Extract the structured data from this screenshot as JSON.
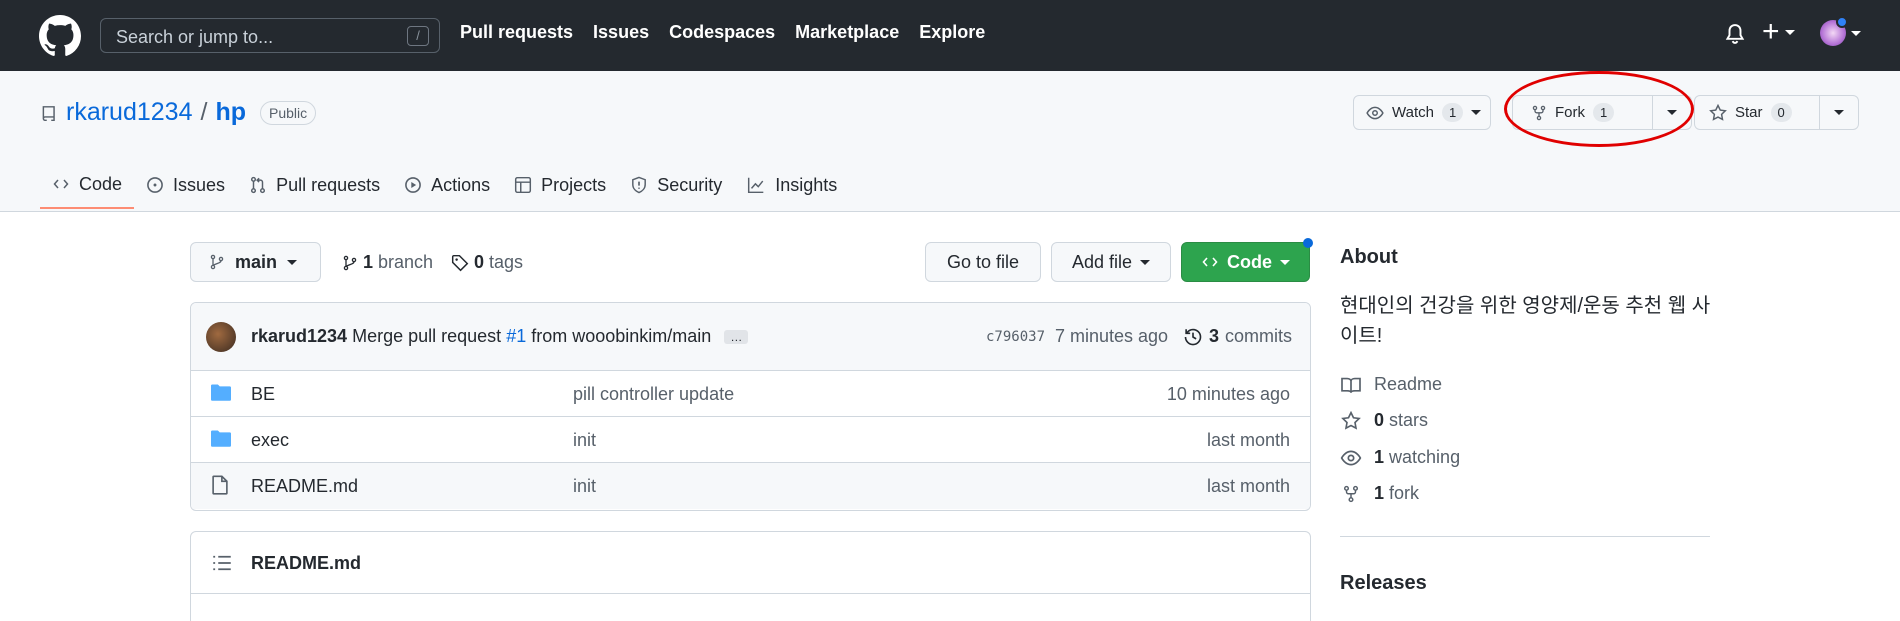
{
  "topbar": {
    "search_placeholder": "Search or jump to...",
    "search_key": "/",
    "nav": [
      "Pull requests",
      "Issues",
      "Codespaces",
      "Marketplace",
      "Explore"
    ],
    "plus_label": "+"
  },
  "repo": {
    "owner": "rkarud1234",
    "separator": "/",
    "name": "hp",
    "visibility": "Public",
    "watch": {
      "label": "Watch",
      "count": "1"
    },
    "fork": {
      "label": "Fork",
      "count": "1"
    },
    "star": {
      "label": "Star",
      "count": "0"
    }
  },
  "tabs": [
    {
      "label": "Code",
      "icon": "code-icon",
      "active": true
    },
    {
      "label": "Issues",
      "icon": "issue-icon"
    },
    {
      "label": "Pull requests",
      "icon": "pull-request-icon"
    },
    {
      "label": "Actions",
      "icon": "play-icon"
    },
    {
      "label": "Projects",
      "icon": "table-icon"
    },
    {
      "label": "Security",
      "icon": "shield-icon"
    },
    {
      "label": "Insights",
      "icon": "graph-icon"
    }
  ],
  "toolbar": {
    "branch": "main",
    "branch_count": "1",
    "branch_label": "branch",
    "tag_count": "0",
    "tag_label": "tags",
    "goto_file": "Go to file",
    "add_file": "Add file",
    "code": "Code"
  },
  "commit": {
    "author": "rkarud1234",
    "message_before": "Merge pull request",
    "pr_ref": "#1",
    "message_after": "from wooobinkim/main",
    "dots": "…",
    "sha": "c796037",
    "time": "7 minutes ago",
    "commit_count": "3",
    "commit_label": "commits"
  },
  "files": [
    {
      "name": "BE",
      "type": "folder",
      "message": "pill controller update",
      "time": "10 minutes ago"
    },
    {
      "name": "exec",
      "type": "folder",
      "message": "init",
      "time": "last month"
    },
    {
      "name": "README.md",
      "type": "file",
      "message": "init",
      "time": "last month"
    }
  ],
  "readme": {
    "title": "README.md"
  },
  "about": {
    "title": "About",
    "description": "현대인의 건강을 위한 영양제/운동 추천 웹 사이트!",
    "readme_label": "Readme",
    "stars_count": "0",
    "stars_label": "stars",
    "watching_count": "1",
    "watching_label": "watching",
    "fork_count": "1",
    "fork_label": "fork",
    "releases": "Releases"
  },
  "colors": {
    "header_bg": "#24292f",
    "link": "#0969da",
    "code_button": "#2da44e",
    "active_tab": "#fd8c73",
    "highlight": "#e00000",
    "folder": "#54aeff"
  }
}
